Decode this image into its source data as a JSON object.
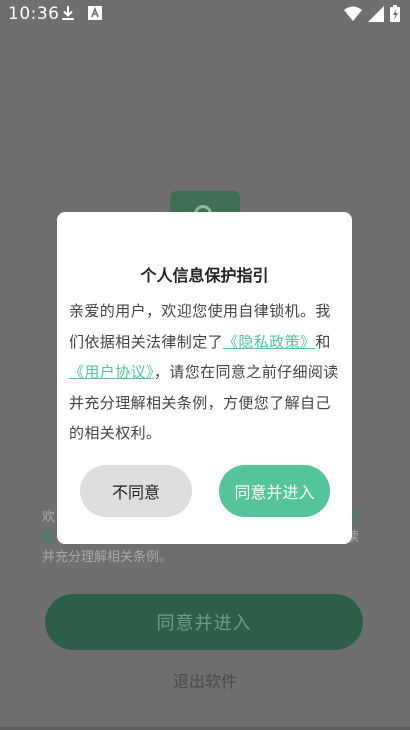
{
  "status_bar": {
    "time": "10:36",
    "left_icons": [
      "download-icon",
      "font-icon"
    ],
    "right_icons": [
      "wifi-icon",
      "signal-icon",
      "battery-icon"
    ]
  },
  "background": {
    "notice_prefix": "欢",
    "notice_link": "私",
    "notice_suffix_right_1": "隐",
    "notice_suffix_right_2": "读",
    "notice_line_3": "并充分理解相关条例。",
    "agree_button": "同意并进入",
    "exit_link": "退出软件"
  },
  "dialog": {
    "title": "个人信息保护指引",
    "body_part1": "亲爱的用户，欢迎您使用自律锁机。我们依据相关法律制定了",
    "privacy_link": "《隐私政策》",
    "body_and": "和",
    "user_agreement_link": "《用户协议》",
    "body_part2": "，请您在同意之前仔细阅读并充分理解相关条例，方便您了解自己的相关权利。",
    "disagree_button": "不同意",
    "agree_button": "同意并进入"
  },
  "colors": {
    "accent": "#56c49a",
    "dim_overlay": "#6f6f6f",
    "bg_button": "#2d5e47"
  }
}
